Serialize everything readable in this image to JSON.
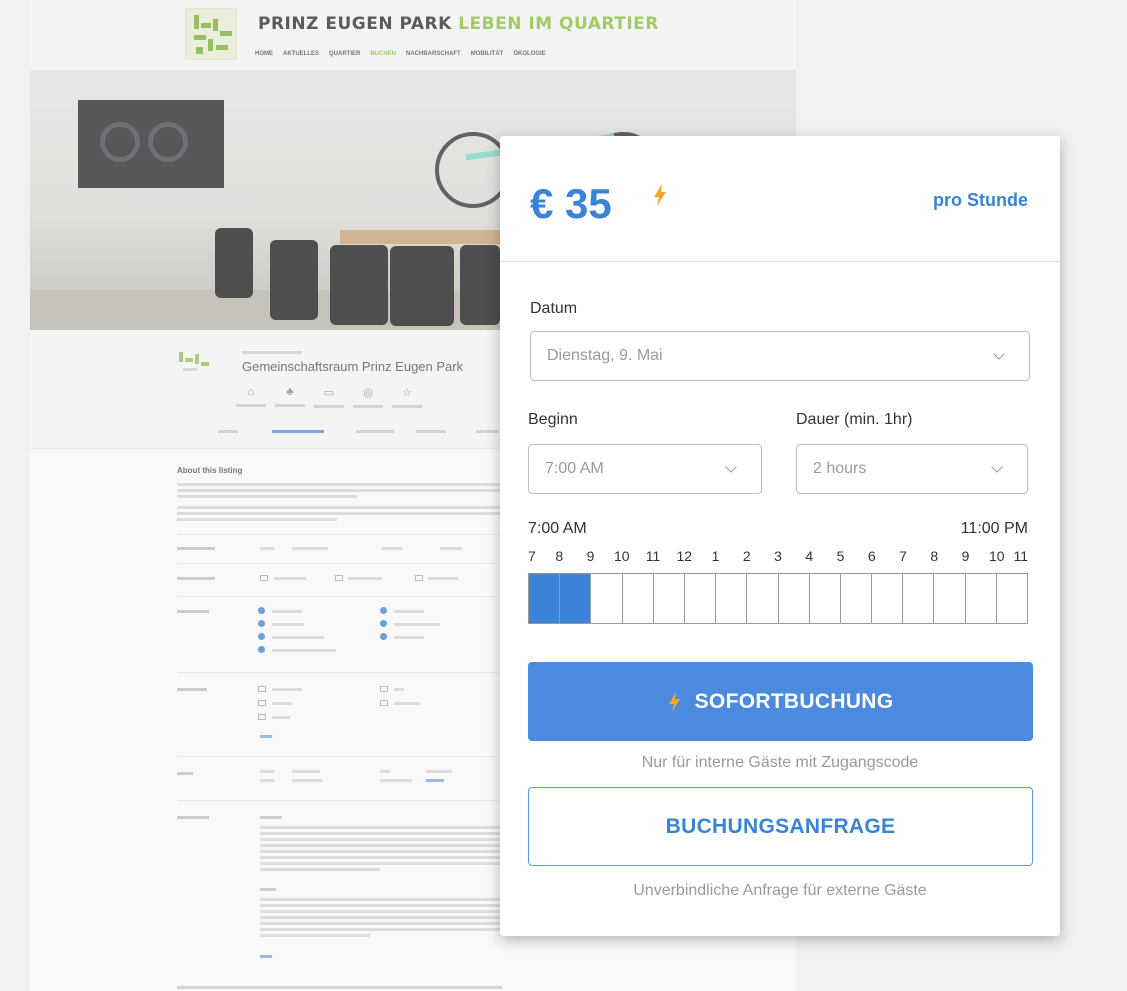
{
  "site": {
    "brand": "PRINZ EUGEN PARK",
    "brand_accent": "LEBEN IM QUARTIER",
    "nav": [
      "HOME",
      "AKTUELLES",
      "QUARTIER",
      "BUCHEN",
      "NACHBARSCHAFT",
      "MOBILITÄT",
      "ÖKOLOGIE"
    ],
    "nav_active_index": 3,
    "listing_title": "Gemeinschaftsraum Prinz Eugen Park",
    "section_heading": "About this listing"
  },
  "booking": {
    "price": "€ 35",
    "per_hour": "pro Stunde",
    "date_label": "Datum",
    "date_value": "Dienstag, 9. Mai",
    "start_label": "Beginn",
    "start_value": "7:00 AM",
    "duration_label": "Dauer  (min. 1hr)",
    "duration_value": "2 hours",
    "range_start": "7:00 AM",
    "range_end": "11:00 PM",
    "hours": [
      "7",
      "8",
      "9",
      "10",
      "11",
      "12",
      "1",
      "2",
      "3",
      "4",
      "5",
      "6",
      "7",
      "8",
      "9",
      "10",
      "11"
    ],
    "slot_count": 16,
    "selected_slots": [
      0,
      1
    ],
    "instant_label": "SOFORTBUCHUNG",
    "instant_note": "Nur für interne Gäste mit Zugangscode",
    "request_label": "BUCHUNGSANFRAGE",
    "request_note": "Unverbindliche Anfrage für externe Gäste"
  },
  "colors": {
    "accent_blue": "#3a83d8",
    "button_blue": "#4a8be0",
    "bolt_orange": "#f5a623",
    "brand_green": "#8cc23f"
  },
  "icons": [
    "lightning-icon",
    "chevron-down-icon"
  ]
}
